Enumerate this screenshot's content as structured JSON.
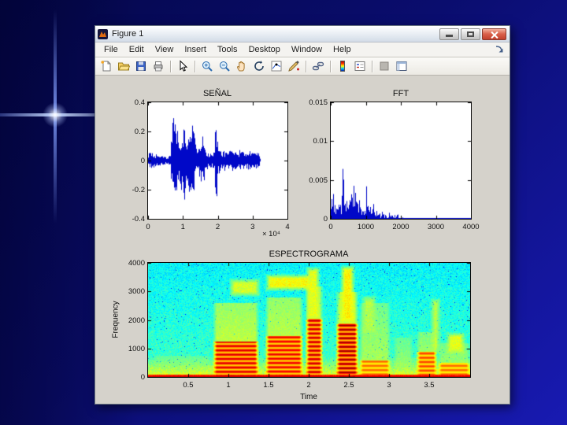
{
  "window": {
    "title": "Figure 1",
    "window_buttons": {
      "minimize": "minimize",
      "maximize": "maximize",
      "close": "close"
    },
    "menus": [
      "File",
      "Edit",
      "View",
      "Insert",
      "Tools",
      "Desktop",
      "Window",
      "Help"
    ],
    "toolbar_icons": [
      "new-figure",
      "open-file",
      "save-figure",
      "print-figure",
      "edit-plot",
      "zoom-in",
      "zoom-out",
      "pan",
      "rotate-3d",
      "data-cursor",
      "brush-data",
      "link-plot",
      "insert-colorbar",
      "insert-legend",
      "hide-plot-tools",
      "show-plot-tools-dock"
    ]
  },
  "colors": {
    "signal": "#0008c8",
    "figure_bg": "#d5d2cb",
    "plot_bg": "#ffffff"
  },
  "chart_data": [
    {
      "type": "line",
      "title": "SEÑAL",
      "xlabel": "",
      "ylabel": "",
      "xlim": [
        0,
        4
      ],
      "ylim": [
        -0.4,
        0.4
      ],
      "xticks": [
        0,
        1,
        2,
        3,
        4
      ],
      "yticks": [
        -0.4,
        -0.2,
        0,
        0.2,
        0.4
      ],
      "x_scale_label": "× 10⁴",
      "color": "#0008c8",
      "envelope": [
        [
          0,
          0.055
        ],
        [
          0.15,
          0.05
        ],
        [
          0.35,
          0.035
        ],
        [
          0.55,
          0.025
        ],
        [
          0.63,
          0.04
        ],
        [
          0.68,
          0.22
        ],
        [
          0.73,
          0.33
        ],
        [
          0.79,
          0.32
        ],
        [
          0.84,
          0.22
        ],
        [
          0.88,
          0.12
        ],
        [
          0.93,
          0.18
        ],
        [
          0.98,
          0.26
        ],
        [
          1.04,
          0.28
        ],
        [
          1.09,
          0.16
        ],
        [
          1.14,
          0.22
        ],
        [
          1.2,
          0.3
        ],
        [
          1.26,
          0.28
        ],
        [
          1.32,
          0.2
        ],
        [
          1.37,
          0.09
        ],
        [
          1.43,
          0.07
        ],
        [
          1.49,
          0.14
        ],
        [
          1.55,
          0.18
        ],
        [
          1.61,
          0.15
        ],
        [
          1.67,
          0.07
        ],
        [
          1.75,
          0.045
        ],
        [
          1.85,
          0.055
        ],
        [
          1.91,
          0.06
        ],
        [
          1.93,
          0.35
        ],
        [
          1.96,
          0.28
        ],
        [
          2.0,
          0.12
        ],
        [
          2.06,
          0.07
        ],
        [
          2.12,
          0.055
        ],
        [
          2.2,
          0.075
        ],
        [
          2.3,
          0.055
        ],
        [
          2.38,
          0.09
        ],
        [
          2.45,
          0.065
        ],
        [
          2.55,
          0.055
        ],
        [
          2.62,
          0.075
        ],
        [
          2.72,
          0.06
        ],
        [
          2.82,
          0.055
        ],
        [
          2.9,
          0.07
        ],
        [
          3.0,
          0.05
        ],
        [
          3.08,
          0.055
        ],
        [
          3.15,
          0.06
        ],
        [
          3.2,
          0.03
        ],
        [
          3.22,
          0
        ]
      ]
    },
    {
      "type": "line",
      "title": "FFT",
      "xlabel": "",
      "ylabel": "",
      "xlim": [
        0,
        4000
      ],
      "ylim": [
        0,
        0.015
      ],
      "xticks": [
        0,
        1000,
        2000,
        3000,
        4000
      ],
      "yticks": [
        0,
        0.005,
        0.01,
        0.015
      ],
      "color": "#0008c8",
      "peaks": [
        [
          15,
          0.0032
        ],
        [
          60,
          0.004
        ],
        [
          105,
          0.0022
        ],
        [
          150,
          0.0016
        ],
        [
          200,
          0.0012
        ],
        [
          235,
          0.0028
        ],
        [
          275,
          0.002
        ],
        [
          330,
          0.0079
        ],
        [
          365,
          0.0057
        ],
        [
          410,
          0.0022
        ],
        [
          455,
          0.0026
        ],
        [
          505,
          0.002
        ],
        [
          540,
          0.0024
        ],
        [
          575,
          0.0045
        ],
        [
          615,
          0.0036
        ],
        [
          650,
          0.0043
        ],
        [
          690,
          0.004
        ],
        [
          730,
          0.0036
        ],
        [
          770,
          0.0022
        ],
        [
          810,
          0.0024
        ],
        [
          860,
          0.0014
        ],
        [
          910,
          0.0016
        ],
        [
          960,
          0.0012
        ],
        [
          1010,
          0.0042
        ],
        [
          1045,
          0.0026
        ],
        [
          1090,
          0.0014
        ],
        [
          1130,
          0.0018
        ],
        [
          1180,
          0.0012
        ],
        [
          1240,
          0.0009
        ],
        [
          1310,
          0.0012
        ],
        [
          1390,
          0.0007
        ],
        [
          1460,
          0.0009
        ],
        [
          1560,
          0.0007
        ],
        [
          1660,
          0.0008
        ],
        [
          1760,
          0.0005
        ],
        [
          1870,
          0.0003
        ],
        [
          2050,
          0.0002
        ]
      ]
    },
    {
      "type": "heatmap",
      "title": "ESPECTROGRAMA",
      "xlabel": "Time",
      "ylabel": "Frequency",
      "xlim": [
        0,
        4.01
      ],
      "ylim": [
        0,
        4000
      ],
      "xticks": [
        0.5,
        1,
        1.5,
        2,
        2.5,
        3,
        3.5
      ],
      "yticks": [
        0,
        1000,
        2000,
        3000,
        4000
      ],
      "colormap": "jet",
      "segments": [
        {
          "t0": 0.05,
          "t1": 0.78,
          "fr": 0,
          "fy": 750,
          "i": 0.35,
          "st": false
        },
        {
          "t0": 0.8,
          "t1": 1.38,
          "fr": 1250,
          "fy": 2600,
          "i": 0.85,
          "st": true
        },
        {
          "t0": 1.45,
          "t1": 1.93,
          "fr": 1450,
          "fy": 2800,
          "i": 0.8,
          "st": true
        },
        {
          "t0": 1.95,
          "t1": 2.18,
          "fr": 2050,
          "fy": 3200,
          "i": 0.9,
          "st": true
        },
        {
          "t0": 2.33,
          "t1": 2.62,
          "fr": 1900,
          "fy": 3000,
          "i": 1.0,
          "st": true
        },
        {
          "t0": 2.62,
          "t1": 3.02,
          "fr": 600,
          "fy": 2600,
          "i": 0.5,
          "st": true
        },
        {
          "t0": 3.05,
          "t1": 3.3,
          "fr": 300,
          "fy": 1400,
          "i": 0.4,
          "st": false
        },
        {
          "t0": 3.33,
          "t1": 3.6,
          "fr": 900,
          "fy": 1600,
          "i": 0.6,
          "st": true
        },
        {
          "t0": 3.6,
          "t1": 4.01,
          "fr": 500,
          "fy": 1200,
          "i": 0.5,
          "st": true
        }
      ],
      "patches": [
        {
          "t0": 1.0,
          "t1": 1.4,
          "f0": 2800,
          "f1": 3500,
          "lv": 0.58
        },
        {
          "t0": 1.45,
          "t1": 2.05,
          "f0": 3000,
          "f1": 3650,
          "lv": 0.62
        },
        {
          "t0": 1.95,
          "t1": 2.15,
          "f0": 2000,
          "f1": 3900,
          "lv": 0.6
        },
        {
          "t0": 2.38,
          "t1": 2.58,
          "f0": 1900,
          "f1": 3950,
          "lv": 0.63
        },
        {
          "t0": 2.65,
          "t1": 2.85,
          "f0": 1500,
          "f1": 2900,
          "lv": 0.55
        },
        {
          "t0": 3.5,
          "t1": 3.65,
          "f0": 800,
          "f1": 2800,
          "lv": 0.56
        },
        {
          "t0": 3.7,
          "t1": 3.95,
          "f0": 800,
          "f1": 1600,
          "lv": 0.6
        }
      ]
    }
  ]
}
